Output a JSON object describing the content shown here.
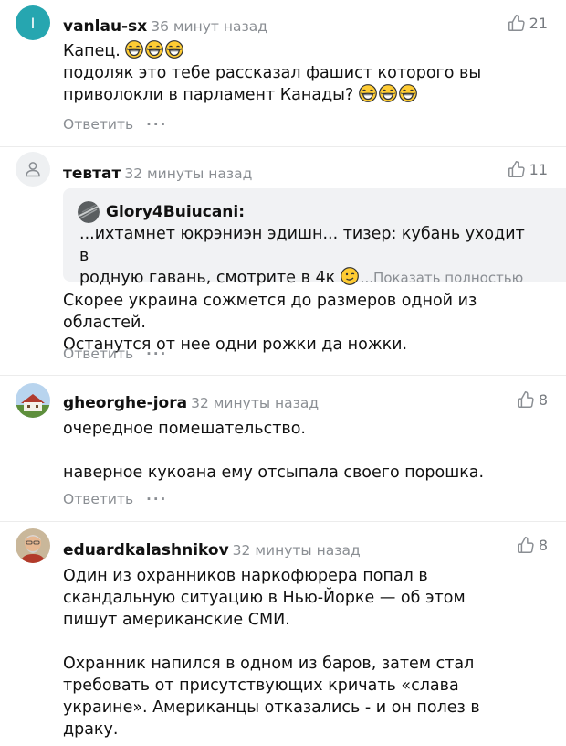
{
  "comments": [
    {
      "avatar_letter": "I",
      "username": "vanlau-sx",
      "time": "36 минут назад",
      "likes": "21",
      "text1": "Капец.",
      "text2": "подоляк это тебе рассказал фашист которого вы",
      "text3": "приволокли в парламент Канады?",
      "reply": "Ответить",
      "more": "···"
    },
    {
      "username": "тевтат",
      "time": "32 минуты назад",
      "likes": "11",
      "quote": {
        "username": "Glory4Buiucani:",
        "line1": "...ихтамнет юкрэниэн эдишн... тизер: кубань уходит в",
        "line2": "родную гавань, смотрите в 4к",
        "show_more": "...Показать полностью"
      },
      "text1": "Скорее украина сожмется до размеров одной из областей.",
      "text2": "Останутся от нее одни рожки да ножки.",
      "reply": "Ответить",
      "more": "···"
    },
    {
      "username": "gheorghe-jora",
      "time": "32 минуты назад",
      "likes": "8",
      "text1": "очередное помешательство.",
      "text2": "наверное кукоана ему отсыпала своего порошка.",
      "reply": "Ответить",
      "more": "···"
    },
    {
      "username": "eduardkalashnikov",
      "time": "32 минуты назад",
      "likes": "8",
      "text1": "Один из охранников наркофюрера попал в",
      "text2": "скандальную ситуацию в Нью-Йорке — об этом",
      "text3": "пишут американские СМИ.",
      "text4": "Охранник напился в одном из баров, затем стал",
      "text5": "требовать от присутствующих кричать «слава",
      "text6": "украине». Американцы отказались - и он полез в",
      "text7": "драку."
    }
  ],
  "colors": {
    "accent": "#26a6b0",
    "muted": "#8a8e93",
    "quote_bg": "#f1f2f4"
  },
  "icons": [
    "user-icon",
    "thumbs-up-icon",
    "laughing-emoji-icon",
    "smirk-emoji-icon"
  ]
}
